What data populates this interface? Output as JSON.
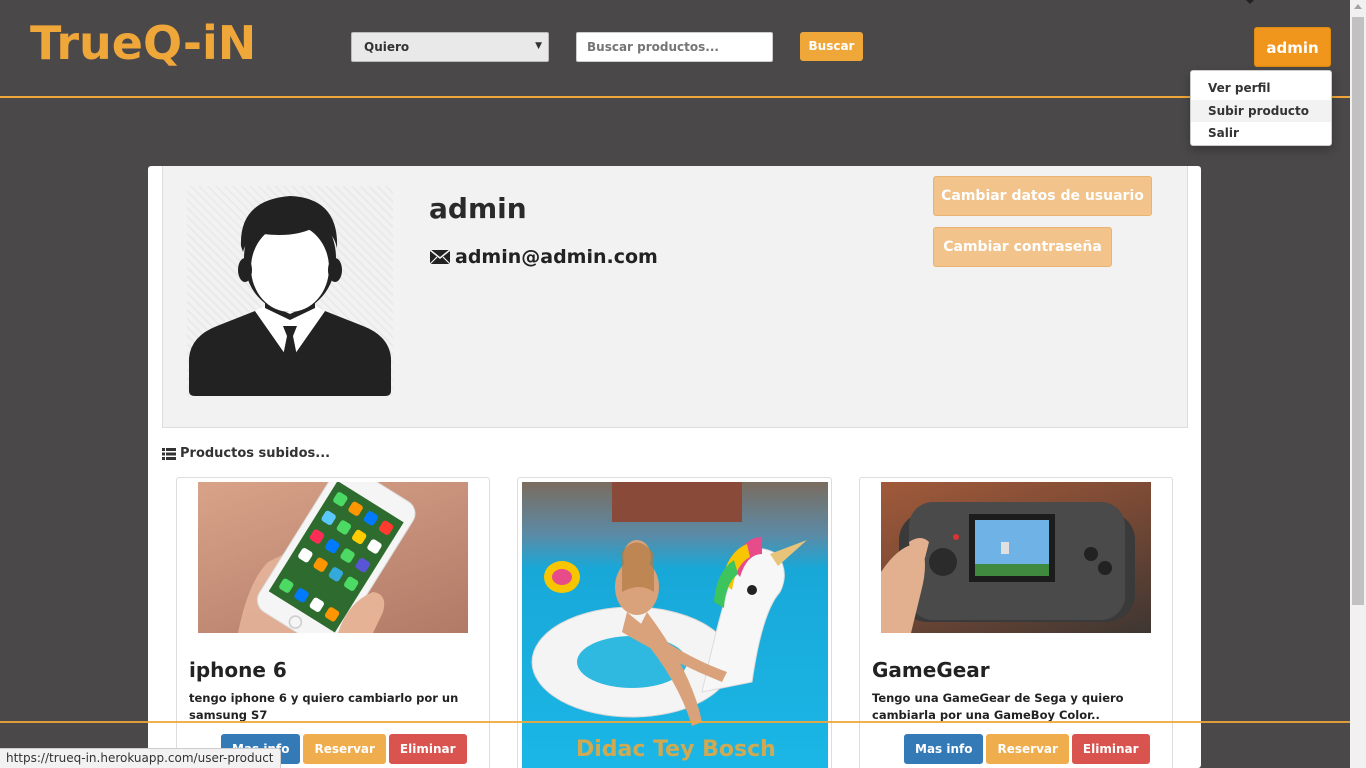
{
  "header": {
    "logo": "TrueQ-iN",
    "filter_select": "Quiero",
    "search_placeholder": "Buscar productos...",
    "search_button": "Buscar",
    "user_button": "admin"
  },
  "dropdown": {
    "items": [
      "Ver perfil",
      "Subir producto",
      "Salir"
    ],
    "highlighted": "Subir producto"
  },
  "profile": {
    "username": "admin",
    "email": "admin@admin.com",
    "change_data_button": "Cambiar datos de usuario",
    "change_password_button": "Cambiar contraseña"
  },
  "products": {
    "heading": "Productos subidos...",
    "items": [
      {
        "title": "iphone 6",
        "description": "tengo iphone 6 y quiero cambiarlo por un samsung S7",
        "info_button": "Mas info",
        "reserve_button": "Reservar",
        "delete_button": "Eliminar"
      },
      {
        "title": "",
        "image_caption": "Didac Tey Bosch",
        "description": ""
      },
      {
        "title": "GameGear",
        "description": "Tengo una GameGear de Sega y quiero cambiarla por una GameBoy Color..",
        "info_button": "Mas info",
        "reserve_button": "Reservar",
        "delete_button": "Eliminar"
      }
    ]
  },
  "status_bar": {
    "url": "https://trueq-in.herokuapp.com/user-product"
  },
  "colors": {
    "accent": "#f0a73a",
    "background": "#4a4849",
    "info": "#337ab7",
    "reserve": "#f0ad4e",
    "delete": "#d9534f"
  }
}
